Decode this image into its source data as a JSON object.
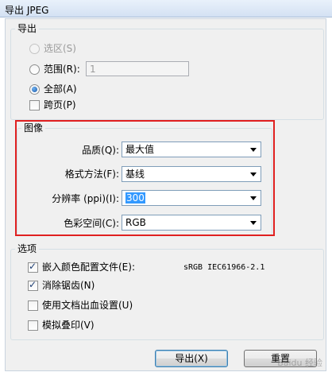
{
  "window": {
    "title": "导出 JPEG"
  },
  "export_group": {
    "legend": "导出",
    "selection": {
      "label": "选区(S)",
      "enabled": false,
      "checked": false
    },
    "range": {
      "label": "范围(R):",
      "value": "1",
      "checked": false
    },
    "all": {
      "label": "全部(A)",
      "checked": true
    },
    "spreads": {
      "label": "跨页(P)",
      "checked": false
    }
  },
  "image_group": {
    "legend": "图像",
    "quality": {
      "label": "品质(Q):",
      "value": "最大值"
    },
    "format_method": {
      "label": "格式方法(F):",
      "value": "基线"
    },
    "resolution": {
      "label": "分辨率 (ppi)(I):",
      "value": "300"
    },
    "color_space": {
      "label": "色彩空间(C):",
      "value": "RGB"
    }
  },
  "options_group": {
    "legend": "选项",
    "embed_profile": {
      "label": "嵌入颜色配置文件(E):",
      "checked": true,
      "profile": "sRGB IEC61966-2.1"
    },
    "anti_alias": {
      "label": "消除锯齿(N)",
      "checked": true
    },
    "use_bleed": {
      "label": "使用文档出血设置(U)",
      "checked": false
    },
    "simulate_overprint": {
      "label": "模拟叠印(V)",
      "checked": false
    }
  },
  "buttons": {
    "export": "导出(X)",
    "reset": "重置"
  },
  "watermark": "Baidu 经验"
}
